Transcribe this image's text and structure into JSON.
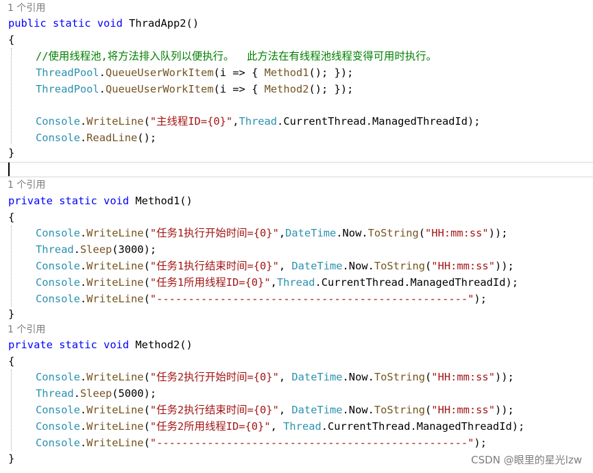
{
  "code_lens": "1 个引用",
  "block1": {
    "signature": {
      "kw1": "public",
      "kw2": "static",
      "kw3": "void",
      "name": "ThradApp2",
      "paren": "()"
    },
    "open_brace": "{",
    "comment": "//使用线程池,将方法排入队列以便执行。  此方法在有线程池线程变得可用时执行。",
    "queue1": {
      "type": "ThreadPool",
      "dot": ".",
      "method": "QueueUserWorkItem",
      "args_pre": "(i => { ",
      "call": "Method1",
      "args_post": "(); });"
    },
    "queue2": {
      "type": "ThreadPool",
      "dot": ".",
      "method": "QueueUserWorkItem",
      "args_pre": "(i => { ",
      "call": "Method2",
      "args_post": "(); });"
    },
    "writeline": {
      "type": "Console",
      "dot": ".",
      "method": "WriteLine",
      "open": "(",
      "str": "\"主线程ID={0}\"",
      "comma": ",",
      "type2": "Thread",
      "rest": ".CurrentThread.ManagedThreadId);"
    },
    "readline": {
      "type": "Console",
      "dot": ".",
      "method": "ReadLine",
      "rest": "();"
    },
    "close_brace": "}"
  },
  "block2": {
    "signature": {
      "kw1": "private",
      "kw2": "static",
      "kw3": "void",
      "name": "Method1",
      "paren": "()"
    },
    "open_brace": "{",
    "l1": {
      "type": "Console",
      "dot": ".",
      "method": "WriteLine",
      "open": "(",
      "str": "\"任务1执行开始时间={0}\"",
      "comma": ",",
      "type2": "DateTime",
      "mid": ".Now.",
      "method2": "ToString",
      "open2": "(",
      "str2": "\"HH:mm:ss\"",
      "close": "));"
    },
    "l2": {
      "type": "Thread",
      "dot": ".",
      "method": "Sleep",
      "rest": "(3000);"
    },
    "l3": {
      "type": "Console",
      "dot": ".",
      "method": "WriteLine",
      "open": "(",
      "str": "\"任务1执行结束时间={0}\"",
      "comma": ", ",
      "type2": "DateTime",
      "mid": ".Now.",
      "method2": "ToString",
      "open2": "(",
      "str2": "\"HH:mm:ss\"",
      "close": "));"
    },
    "l4": {
      "type": "Console",
      "dot": ".",
      "method": "WriteLine",
      "open": "(",
      "str": "\"任务1所用线程ID={0}\"",
      "comma": ",",
      "type2": "Thread",
      "rest": ".CurrentThread.ManagedThreadId);"
    },
    "l5": {
      "type": "Console",
      "dot": ".",
      "method": "WriteLine",
      "open": "(",
      "str": "\"-------------------------------------------------\"",
      "close": ");"
    },
    "close_brace": "}"
  },
  "block3": {
    "signature": {
      "kw1": "private",
      "kw2": "static",
      "kw3": "void",
      "name": "Method2",
      "paren": "()"
    },
    "open_brace": "{",
    "l1": {
      "type": "Console",
      "dot": ".",
      "method": "WriteLine",
      "open": "(",
      "str": "\"任务2执行开始时间={0}\"",
      "comma": ", ",
      "type2": "DateTime",
      "mid": ".Now.",
      "method2": "ToString",
      "open2": "(",
      "str2": "\"HH:mm:ss\"",
      "close": "));"
    },
    "l2": {
      "type": "Thread",
      "dot": ".",
      "method": "Sleep",
      "rest": "(5000);"
    },
    "l3": {
      "type": "Console",
      "dot": ".",
      "method": "WriteLine",
      "open": "(",
      "str": "\"任务2执行结束时间={0}\"",
      "comma": ", ",
      "type2": "DateTime",
      "mid": ".Now.",
      "method2": "ToString",
      "open2": "(",
      "str2": "\"HH:mm:ss\"",
      "close": "));"
    },
    "l4": {
      "type": "Console",
      "dot": ".",
      "method": "WriteLine",
      "open": "(",
      "str": "\"任务2所用线程ID={0}\"",
      "comma": ", ",
      "type2": "Thread",
      "rest": ".CurrentThread.ManagedThreadId);"
    },
    "l5": {
      "type": "Console",
      "dot": ".",
      "method": "WriteLine",
      "open": "(",
      "str": "\"-------------------------------------------------\"",
      "close": ");"
    },
    "close_brace": "}"
  },
  "watermark": "CSDN @眼里的星光lzw",
  "colors": {
    "keyword": "#0000ff",
    "type": "#2b91af",
    "method": "#74531f",
    "string": "#a31515",
    "comment": "#008000",
    "code_lens": "#7a7a7a"
  }
}
